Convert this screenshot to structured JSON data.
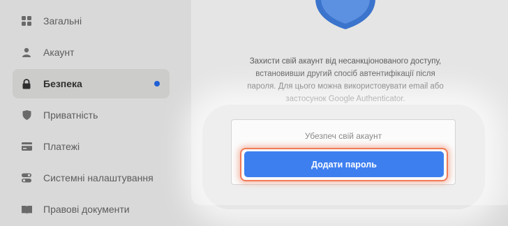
{
  "sidebar": {
    "items": [
      {
        "label": "Загальні",
        "icon": "grid-icon",
        "active": false
      },
      {
        "label": "Акаунт",
        "icon": "user-icon",
        "active": false
      },
      {
        "label": "Безпека",
        "icon": "lock-icon",
        "active": true
      },
      {
        "label": "Приватність",
        "icon": "shield-icon",
        "active": false
      },
      {
        "label": "Платежі",
        "icon": "credit-card-icon",
        "active": false
      },
      {
        "label": "Системні налаштування",
        "icon": "toggles-icon",
        "active": false
      },
      {
        "label": "Правові документи",
        "icon": "book-icon",
        "active": false
      }
    ]
  },
  "security": {
    "description_lines": [
      "Захисти свій акаунт від несанкціонованого доступу,",
      "встановивши другий спосіб автентифікації після",
      "пароля. Для цього можна використовувати email або",
      "застосунок Google Authenticator."
    ],
    "box_title": "Убезпеч свій акаунт",
    "add_password_label": "Додати пароль"
  },
  "colors": {
    "accent": "#3e7ff0",
    "highlight": "#f07b57",
    "active_dot": "#1f5fd6"
  }
}
